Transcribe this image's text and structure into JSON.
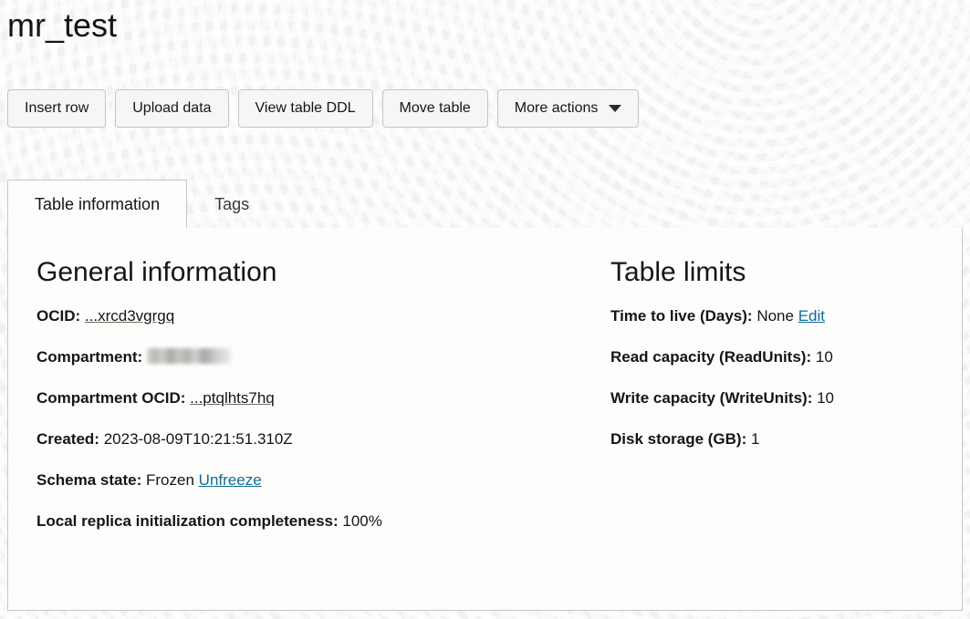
{
  "page": {
    "title": "mr_test"
  },
  "actions": [
    {
      "id": "insert-row",
      "label": "Insert row",
      "has_caret": false
    },
    {
      "id": "upload-data",
      "label": "Upload data",
      "has_caret": false
    },
    {
      "id": "view-ddl",
      "label": "View table DDL",
      "has_caret": false
    },
    {
      "id": "move-table",
      "label": "Move table",
      "has_caret": false
    },
    {
      "id": "more-actions",
      "label": "More actions",
      "has_caret": true
    }
  ],
  "tabs": [
    {
      "id": "table-information",
      "label": "Table information",
      "active": true
    },
    {
      "id": "tags",
      "label": "Tags",
      "active": false
    }
  ],
  "general_information": {
    "heading": "General information",
    "ocid": {
      "label": "OCID:",
      "value": "...xrcd3vgrgq"
    },
    "compartment": {
      "label": "Compartment:",
      "value": ""
    },
    "compartment_ocid": {
      "label": "Compartment OCID:",
      "value": "...ptqlhts7hq"
    },
    "created": {
      "label": "Created:",
      "value": "2023-08-09T10:21:51.310Z"
    },
    "schema_state": {
      "label": "Schema state:",
      "value": "Frozen",
      "action_label": "Unfreeze"
    },
    "local_replica": {
      "label": "Local replica initialization completeness:",
      "value": "100%"
    }
  },
  "table_limits": {
    "heading": "Table limits",
    "time_to_live": {
      "label": "Time to live (Days):",
      "value": "None",
      "action_label": "Edit"
    },
    "read_capacity": {
      "label": "Read capacity (ReadUnits):",
      "value": "10"
    },
    "write_capacity": {
      "label": "Write capacity (WriteUnits):",
      "value": "10"
    },
    "disk_storage": {
      "label": "Disk storage (GB):",
      "value": "1"
    }
  },
  "icons": {
    "more_actions_caret": "chevron-down-icon"
  },
  "colors": {
    "link": "#0f6c96",
    "text": "#161513",
    "panel_background": "#fdfdfb",
    "page_background": "#f2f1ef",
    "button_background": "#f7f6f4",
    "border": "#c9c7c4"
  }
}
